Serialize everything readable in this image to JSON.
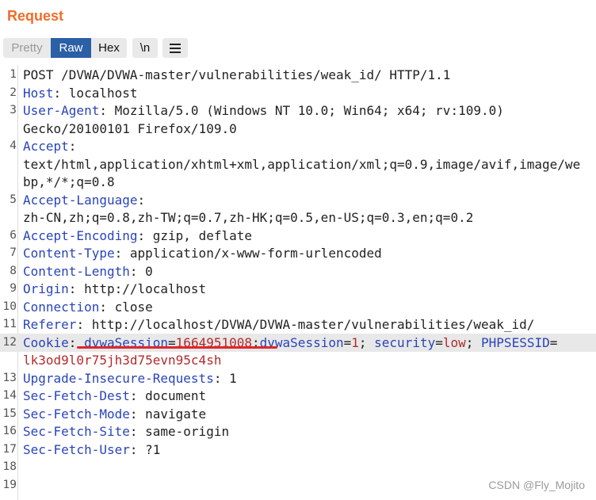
{
  "panel": {
    "title": "Request"
  },
  "toolbar": {
    "tabs": [
      "Pretty",
      "Raw",
      "Hex"
    ],
    "newline_label": "\\n"
  },
  "lines": [
    {
      "n": "1",
      "type": "plain",
      "text": "POST /DVWA/DVWA-master/vulnerabilities/weak_id/ HTTP/1.1"
    },
    {
      "n": "2",
      "type": "header",
      "key": "Host",
      "value": ": localhost"
    },
    {
      "n": "3",
      "type": "header",
      "key": "User-Agent",
      "value": ": Mozilla/5.0 (Windows NT 10.0; Win64; x64; rv:109.0)"
    },
    {
      "n": "",
      "type": "plain",
      "text": "Gecko/20100101 Firefox/109.0"
    },
    {
      "n": "4",
      "type": "header",
      "key": "Accept",
      "value": ":"
    },
    {
      "n": "",
      "type": "plain",
      "text": "text/html,application/xhtml+xml,application/xml;q=0.9,image/avif,image/we"
    },
    {
      "n": "",
      "type": "plain",
      "text": "bp,*/*;q=0.8"
    },
    {
      "n": "5",
      "type": "header",
      "key": "Accept-Language",
      "value": ":"
    },
    {
      "n": "",
      "type": "plain",
      "text": "zh-CN,zh;q=0.8,zh-TW;q=0.7,zh-HK;q=0.5,en-US;q=0.3,en;q=0.2"
    },
    {
      "n": "6",
      "type": "header",
      "key": "Accept-Encoding",
      "value": ": gzip, deflate"
    },
    {
      "n": "7",
      "type": "header",
      "key": "Content-Type",
      "value": ": application/x-www-form-urlencoded"
    },
    {
      "n": "8",
      "type": "header",
      "key": "Content-Length",
      "value": ": 0"
    },
    {
      "n": "9",
      "type": "header",
      "key": "Origin",
      "value": ": http://localhost"
    },
    {
      "n": "10",
      "type": "header",
      "key": "Connection",
      "value": ": close"
    },
    {
      "n": "11",
      "type": "header",
      "key": "Referer",
      "value": ": http://localhost/DVWA/DVWA-master/vulnerabilities/weak_id/"
    },
    {
      "n": "12",
      "type": "cookie",
      "active": true,
      "parts": [
        {
          "t": "Cookie",
          "c": "hk"
        },
        {
          "t": ": ",
          "c": ""
        },
        {
          "t": "dvwaSession",
          "c": "ck"
        },
        {
          "t": "=",
          "c": ""
        },
        {
          "t": "1664951008",
          "c": "cv"
        },
        {
          "t": ";",
          "c": ""
        },
        {
          "t": "dvwaSession",
          "c": "ck"
        },
        {
          "t": "=",
          "c": ""
        },
        {
          "t": "1",
          "c": "cv"
        },
        {
          "t": "; ",
          "c": ""
        },
        {
          "t": "security",
          "c": "ck"
        },
        {
          "t": "=",
          "c": ""
        },
        {
          "t": "low",
          "c": "cv"
        },
        {
          "t": "; ",
          "c": ""
        },
        {
          "t": "PHPSESSID",
          "c": "ck"
        },
        {
          "t": "=",
          "c": ""
        }
      ]
    },
    {
      "n": "",
      "type": "cookie",
      "parts": [
        {
          "t": "lk3od9l0r75jh3d75evn95c4sh",
          "c": "cv"
        }
      ]
    },
    {
      "n": "13",
      "type": "header",
      "key": "Upgrade-Insecure-Requests",
      "value": ": 1"
    },
    {
      "n": "14",
      "type": "header",
      "key": "Sec-Fetch-Dest",
      "value": ": document"
    },
    {
      "n": "15",
      "type": "header",
      "key": "Sec-Fetch-Mode",
      "value": ": navigate"
    },
    {
      "n": "16",
      "type": "header",
      "key": "Sec-Fetch-Site",
      "value": ": same-origin"
    },
    {
      "n": "17",
      "type": "header",
      "key": "Sec-Fetch-User",
      "value": ": ?1"
    },
    {
      "n": "18",
      "type": "plain",
      "text": ""
    },
    {
      "n": "19",
      "type": "plain",
      "text": ""
    }
  ],
  "watermark": "CSDN @Fly_Mojito",
  "colors": {
    "title": "#f26c28",
    "active_tab": "#2b5fa6",
    "header_key": "#2945b8",
    "cookie_value": "#b32a2a",
    "underline": "#e0262d"
  }
}
